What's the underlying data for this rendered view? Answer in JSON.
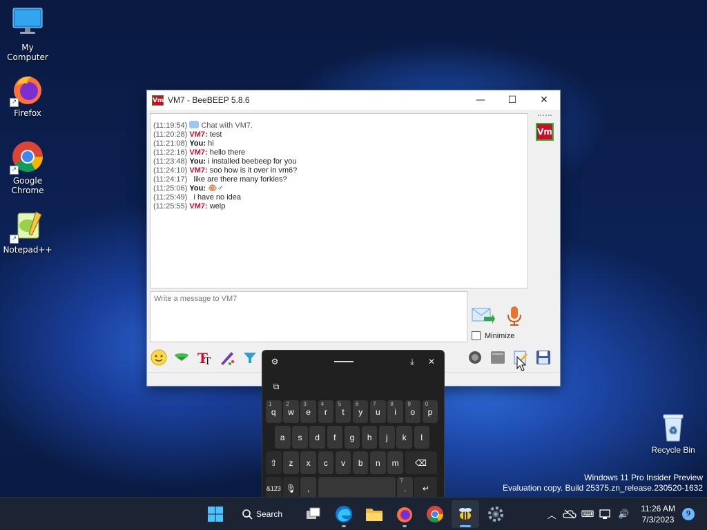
{
  "desktop": {
    "icons": [
      {
        "label": "My Computer"
      },
      {
        "label": "Firefox"
      },
      {
        "label": "Google Chrome"
      },
      {
        "label": "Notepad++"
      }
    ],
    "recycle_bin": "Recycle Bin",
    "watermark": {
      "line1": "Windows 11 Pro Insider Preview",
      "line2": "Evaluation copy. Build 25375.zn_release.230520-1632"
    }
  },
  "window": {
    "logo_text": "Vm",
    "title": "VM7 - BeeBEEP 5.8.6",
    "controls": {
      "minimize": "—",
      "maximize": "☐",
      "close": "✕"
    },
    "messages": [
      {
        "ts": "(11:19:54)",
        "who": "",
        "text": " Chat with VM7.",
        "kind": "system"
      },
      {
        "ts": "(11:20:28)",
        "who": "VM7:",
        "text": " test",
        "kind": "vm"
      },
      {
        "ts": "(11:21:08)",
        "who": "You:",
        "text": " hi",
        "kind": "you"
      },
      {
        "ts": "(11:22:16)",
        "who": "VM7:",
        "text": " hello there",
        "kind": "vm"
      },
      {
        "ts": "(11:23:48)",
        "who": "You:",
        "text": " i installed beebeep for you",
        "kind": "you"
      },
      {
        "ts": "(11:24:10)",
        "who": "VM7:",
        "text": " soo how is it over in vm6?",
        "kind": "vm"
      },
      {
        "ts": "(11:24:17)",
        "who": "",
        "text": "  like are there many forkies?",
        "kind": "cont"
      },
      {
        "ts": "(11:25:06)",
        "who": "You:",
        "text": " 🐵♂",
        "kind": "you"
      },
      {
        "ts": "(11:25:49)",
        "who": "",
        "text": "  i have no idea",
        "kind": "cont"
      },
      {
        "ts": "(11:25:55)",
        "who": "VM7:",
        "text": " welp",
        "kind": "vm"
      }
    ],
    "input_placeholder": "Write a message to VM7",
    "minimize_label": "Minimize",
    "user_avatar": "Vm"
  },
  "keyboard": {
    "row1": [
      {
        "num": "1",
        "key": "q"
      },
      {
        "num": "2",
        "key": "w"
      },
      {
        "num": "3",
        "key": "e"
      },
      {
        "num": "4",
        "key": "r"
      },
      {
        "num": "5",
        "key": "t"
      },
      {
        "num": "6",
        "key": "y"
      },
      {
        "num": "7",
        "key": "u"
      },
      {
        "num": "8",
        "key": "i"
      },
      {
        "num": "9",
        "key": "o"
      },
      {
        "num": "0",
        "key": "p"
      }
    ],
    "row2": [
      "a",
      "s",
      "d",
      "f",
      "g",
      "h",
      "j",
      "k",
      "l"
    ],
    "row3": [
      "z",
      "x",
      "c",
      "v",
      "b",
      "n",
      "m"
    ],
    "symbols_key": "&123",
    "comma_key": ",",
    "period_key": ".",
    "period_alt": "?",
    "shift_glyph": "⇧",
    "backspace_glyph": "⌫",
    "enter_glyph": "↵",
    "mic_glyph": "🎙",
    "settings_glyph": "⚙",
    "dock_glyph": "⤓",
    "close_glyph": "✕",
    "clipboard_glyph": "⧉"
  },
  "taskbar": {
    "search_label": "Search",
    "time": "11:26 AM",
    "date": "7/3/2023",
    "notifications": "9",
    "tray_glyphs": {
      "chevron": "︿",
      "keyboard": "⌨",
      "volume": "🔊"
    }
  }
}
